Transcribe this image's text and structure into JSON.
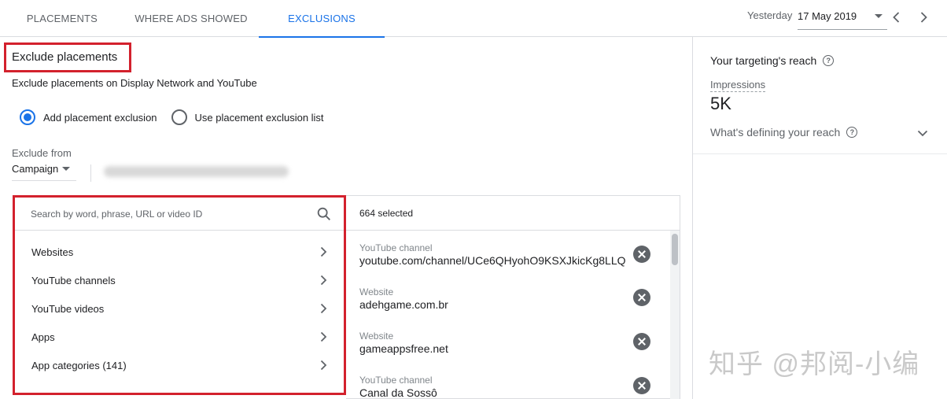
{
  "tabs": [
    {
      "label": "PLACEMENTS",
      "active": false
    },
    {
      "label": "WHERE ADS SHOWED",
      "active": false
    },
    {
      "label": "EXCLUSIONS",
      "active": true
    }
  ],
  "date": {
    "prefix": "Yesterday",
    "value": "17 May 2019"
  },
  "heading": "Exclude placements",
  "subtitle": "Exclude placements on Display Network and YouTube",
  "radios": [
    {
      "label": "Add placement exclusion",
      "checked": true
    },
    {
      "label": "Use placement exclusion list",
      "checked": false
    }
  ],
  "exclude_from": {
    "label": "Exclude from",
    "value": "Campaign"
  },
  "search": {
    "placeholder": "Search by word, phrase, URL or video ID"
  },
  "categories": [
    {
      "label": "Websites"
    },
    {
      "label": "YouTube channels"
    },
    {
      "label": "YouTube videos"
    },
    {
      "label": "Apps"
    },
    {
      "label": "App categories (141)"
    }
  ],
  "selected": {
    "count_label": "664 selected",
    "items": [
      {
        "type": "YouTube channel",
        "value": "youtube.com/channel/UCe6QHyohO9KSXJkicKg8LLQ"
      },
      {
        "type": "Website",
        "value": "adehgame.com.br"
      },
      {
        "type": "Website",
        "value": "gameappsfree.net"
      },
      {
        "type": "YouTube channel",
        "value": "Canal da Sossô"
      }
    ]
  },
  "reach": {
    "title": "Your targeting's reach",
    "impressions_label": "Impressions",
    "impressions_value": "5K",
    "defining_label": "What's defining your reach"
  },
  "watermark": "知乎 @邦阅-小编",
  "colors": {
    "accent": "#1a73e8",
    "highlight": "#d3212d"
  }
}
